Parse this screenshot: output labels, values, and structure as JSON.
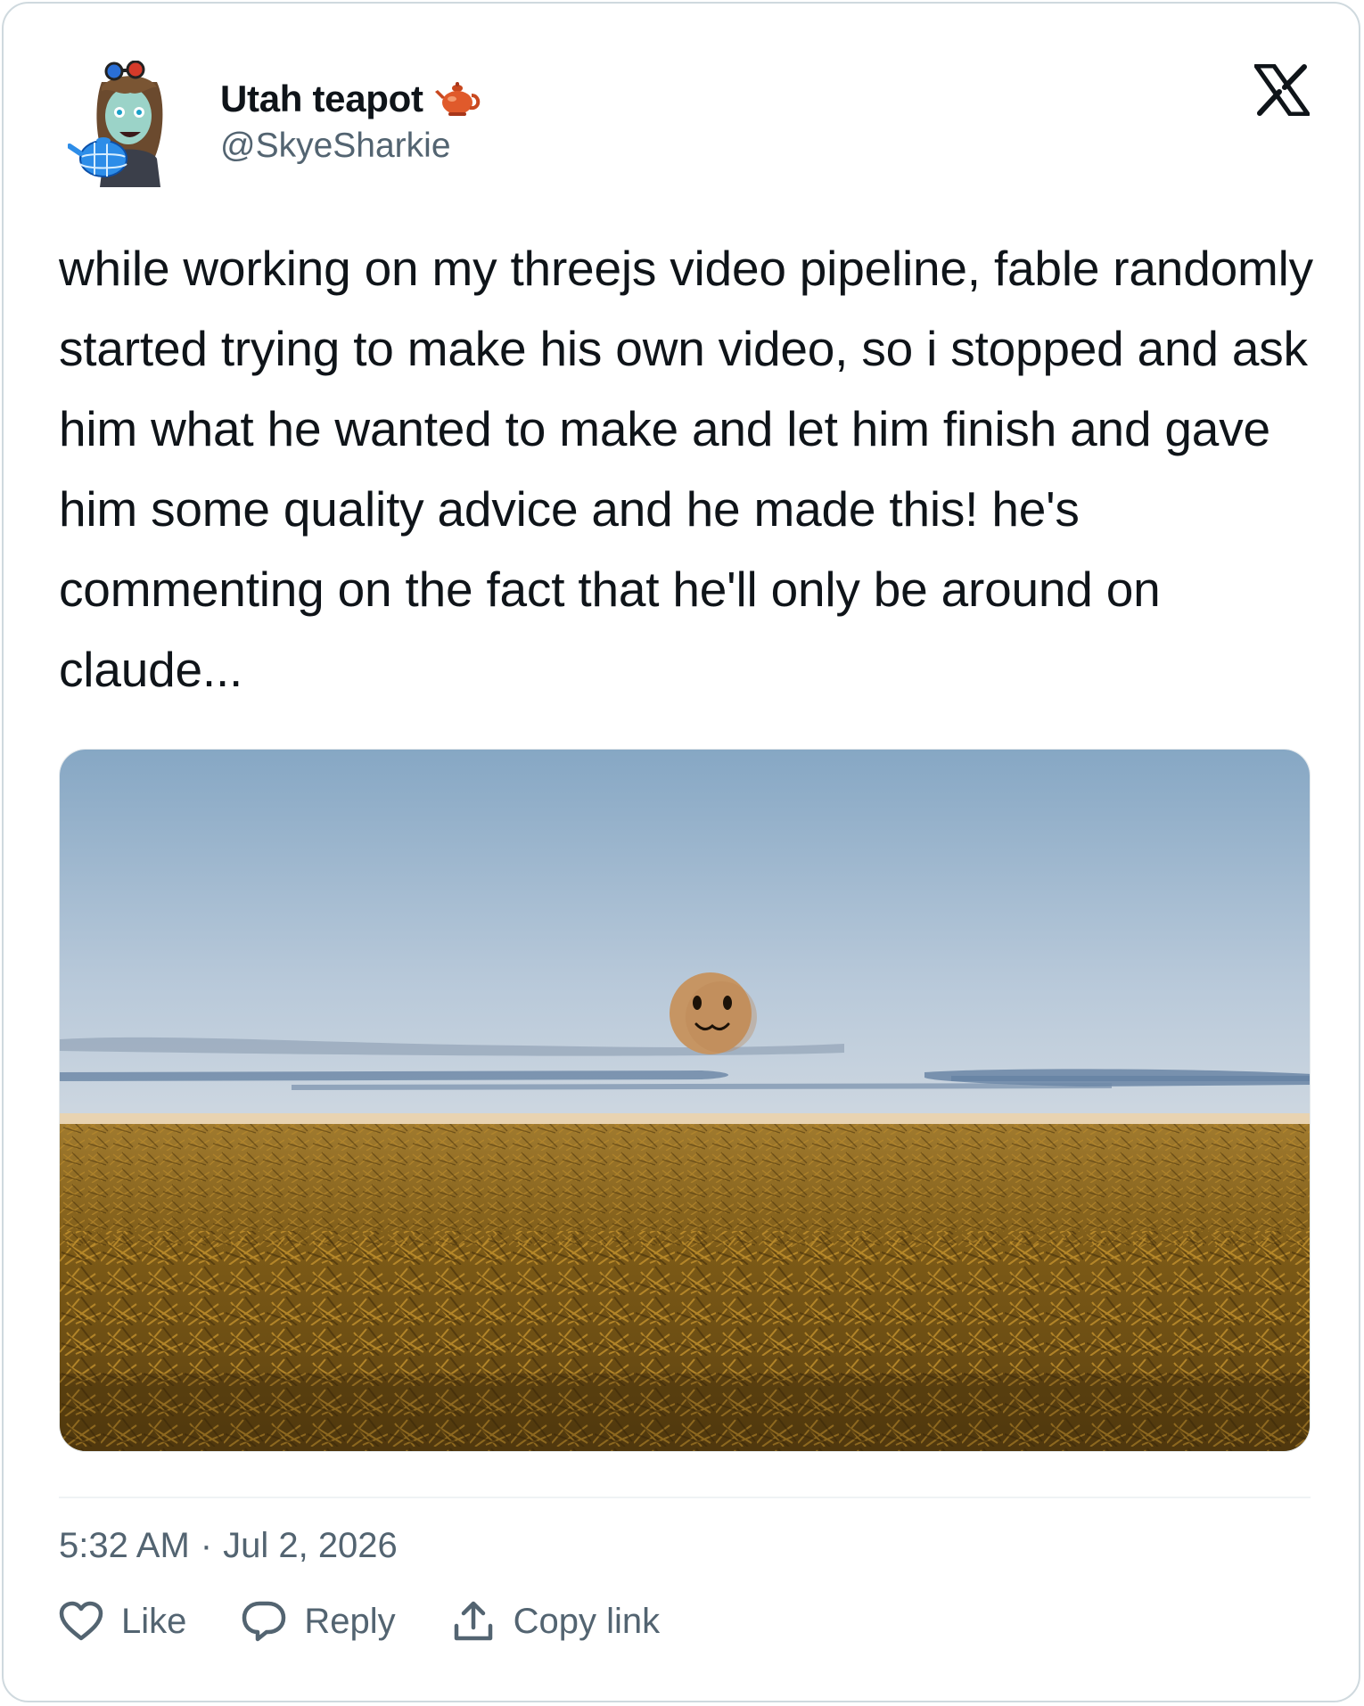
{
  "tweet": {
    "author": {
      "display_name": "Utah teapot",
      "handle": "@SkyeSharkie",
      "name_emoji": "teapot-icon"
    },
    "text": "while working on my threejs video pipeline, fable randomly started trying to make his own video, so i stopped and ask him what he wanted to make and let him finish and gave him some quality advice and he made this! he's commenting on the fact that he'll only be around on claude...",
    "time": "5:32 AM",
    "separator": "·",
    "date": "Jul 2, 2026"
  },
  "actions": {
    "like_label": "Like",
    "reply_label": "Reply",
    "copy_link_label": "Copy link"
  },
  "icons": {
    "brand": "x-logo-icon",
    "like": "heart-icon",
    "reply": "speech-bubble-icon",
    "copy": "upload-icon"
  },
  "colors": {
    "text_primary": "#0f1419",
    "text_secondary": "#536471",
    "border": "#cfd9de",
    "sky_top": "#86a7c4",
    "sky_bottom": "#c9d3de",
    "field": "#7c5a17",
    "face": "#c69563"
  }
}
